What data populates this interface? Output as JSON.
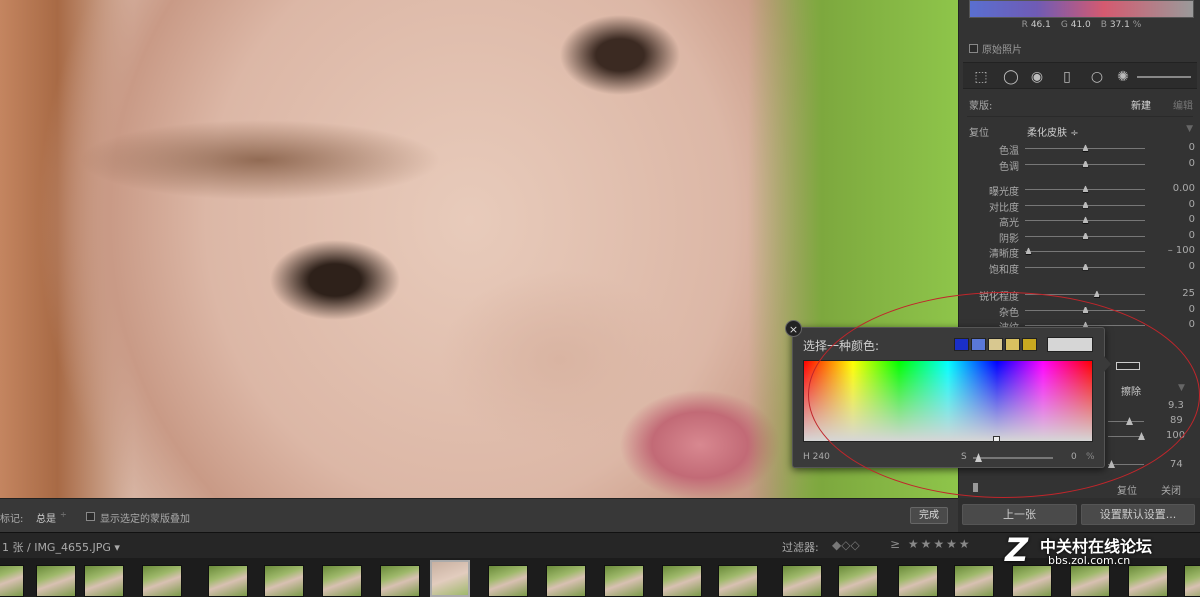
{
  "histogram": {
    "r_label": "R",
    "r": "46.1",
    "g_label": "G",
    "g": "41.0",
    "b_label": "B",
    "b": "37.1",
    "unit": "%"
  },
  "original_photo_label": "原始照片",
  "mask": {
    "label": "蒙版:",
    "new": "新建",
    "edit": "编辑"
  },
  "preset": {
    "reset": "复位",
    "name": "柔化皮肤",
    "caret": "÷"
  },
  "sliders_group1": [
    {
      "label": "色温",
      "value": "0",
      "pos": 0.5
    },
    {
      "label": "色调",
      "value": "0",
      "pos": 0.5
    }
  ],
  "sliders_group2": [
    {
      "label": "曝光度",
      "value": "0.00",
      "pos": 0.5
    },
    {
      "label": "对比度",
      "value": "0",
      "pos": 0.5
    },
    {
      "label": "高光",
      "value": "0",
      "pos": 0.5
    },
    {
      "label": "阴影",
      "value": "0",
      "pos": 0.5
    },
    {
      "label": "清晰度",
      "value": "– 100",
      "pos": 0.0
    },
    {
      "label": "饱和度",
      "value": "0",
      "pos": 0.5
    }
  ],
  "sliders_group3": [
    {
      "label": "锐化程度",
      "value": "25",
      "pos": 0.6
    },
    {
      "label": "杂色",
      "value": "0",
      "pos": 0.5
    },
    {
      "label": "波纹",
      "value": "0",
      "pos": 0.5
    }
  ],
  "brush": {
    "erase": "擦除",
    "v1": "9.3",
    "v2": "89",
    "v3": "100",
    "v4": "74"
  },
  "panel_bottom": {
    "reset": "复位",
    "close": "关闭"
  },
  "picker": {
    "title": "选择一种颜色:",
    "close": "×",
    "swatches": [
      "#1a2fc8",
      "#5a78d8",
      "#d8c890",
      "#d8c060",
      "#c8a820"
    ],
    "h_label": "H",
    "h_value": "240",
    "s_label": "S",
    "s_value": "0",
    "s_unit": "%"
  },
  "toolbar": {
    "mark_label": "标记:",
    "mark_value": "总是",
    "mark_caret": "÷",
    "overlay_label": "显示选定的蒙版叠加",
    "done": "完成"
  },
  "buttons": {
    "prev": "上一张",
    "defaults": "设置默认设置..."
  },
  "filmbar": {
    "file": "1 张 / IMG_4655.JPG ▾",
    "filter": "过滤器:",
    "stars": "≥ ★★★★★"
  },
  "watermark": {
    "logo": "Z",
    "name": "中关村在线论坛",
    "url": "bbs.zol.com.cn"
  }
}
